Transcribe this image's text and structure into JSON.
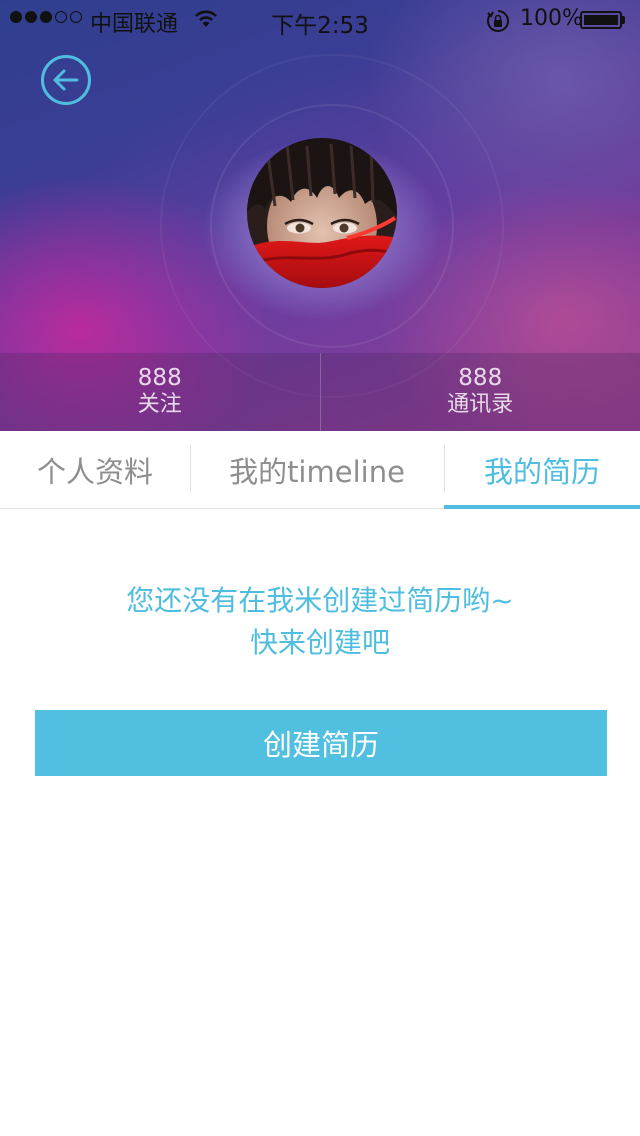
{
  "status_bar": {
    "carrier": "中国联通",
    "time": "下午2:53",
    "battery": "100%",
    "signal_strength": 3,
    "signal_max": 5
  },
  "header": {
    "back_icon": "back-arrow-icon",
    "avatar": "profile-avatar",
    "stats": [
      {
        "value": "888",
        "label": "关注"
      },
      {
        "value": "888",
        "label": "通讯录"
      }
    ]
  },
  "tabs": [
    {
      "label": "个人资料",
      "active": false
    },
    {
      "label": "我的timeline",
      "active": false
    },
    {
      "label": "我的简历",
      "active": true
    }
  ],
  "empty_state": {
    "line1": "您还没有在我米创建过简历哟~",
    "line2": "快来创建吧"
  },
  "create_button": {
    "label": "创建简历"
  },
  "colors": {
    "accent": "#4fbde0",
    "button": "#50bfe0",
    "tab_inactive": "#8e8e8e"
  }
}
